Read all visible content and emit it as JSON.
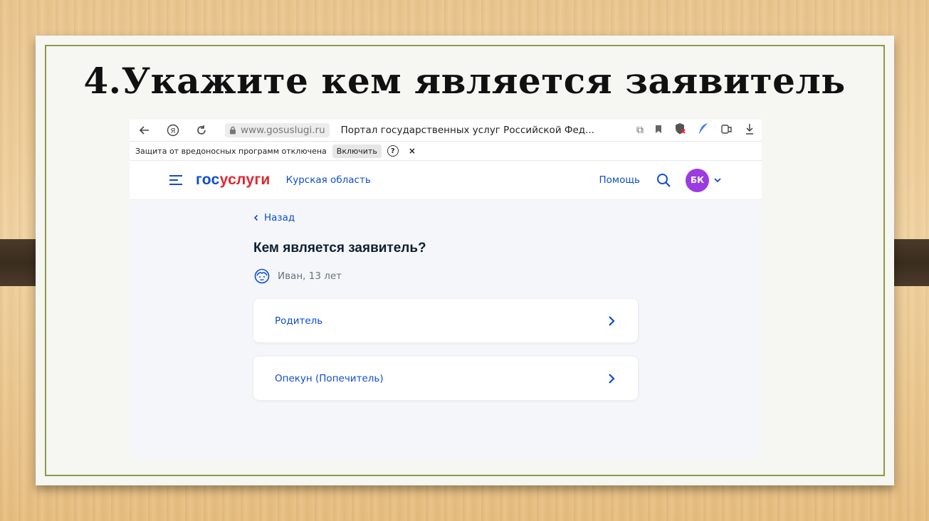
{
  "slide": {
    "title": "4.Укажите кем является заявитель"
  },
  "browser": {
    "url": "www.gosuslugi.ru",
    "tab_title": "Портал государственных услуг Российской Фед...",
    "infobar": {
      "message": "Защита от вредоносных программ отключена",
      "enable_label": "Включить",
      "help_label": "?",
      "close_label": "×"
    }
  },
  "site": {
    "logo_part1": "гос",
    "logo_part2": "услуги",
    "region": "Курская область",
    "help": "Помощь",
    "avatar_initials": "БК",
    "back": "Назад",
    "question": "Кем является заявитель?",
    "child": "Иван, 13 лет",
    "options": [
      {
        "label": "Родитель"
      },
      {
        "label": "Опекун (Попечитель)"
      }
    ]
  },
  "colors": {
    "brand_blue": "#0d4cd3",
    "brand_red": "#e3262d",
    "avatar": "#9c3be0",
    "frame_green": "#8c9b43"
  }
}
